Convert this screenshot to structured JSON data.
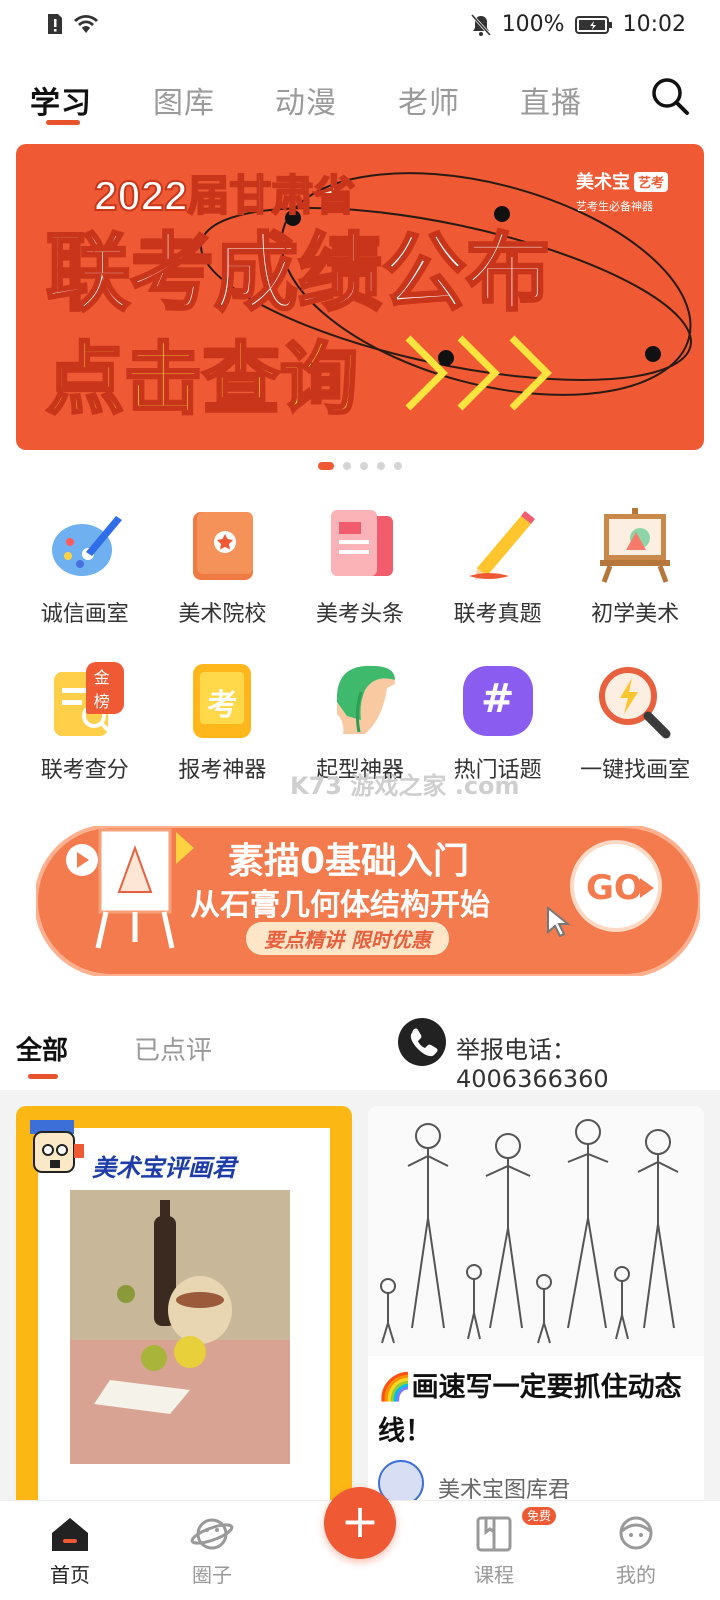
{
  "status_bar": {
    "battery": "100%",
    "time": "10:02"
  },
  "top_tabs": [
    "学习",
    "图库",
    "动漫",
    "老师",
    "直播"
  ],
  "banner": {
    "line1": "2022届甘肃省",
    "line2": "联考成绩公布",
    "line3": "点击查询",
    "brand": "美术宝",
    "brand_tag": "艺考",
    "brand_sub": "艺考生必备神器"
  },
  "grid_row1": [
    {
      "label": "诚信画室",
      "icon": "palette-icon"
    },
    {
      "label": "美术院校",
      "icon": "school-book-icon"
    },
    {
      "label": "美考头条",
      "icon": "news-icon"
    },
    {
      "label": "联考真题",
      "icon": "pencil-icon"
    },
    {
      "label": "初学美术",
      "icon": "easel-icon"
    }
  ],
  "grid_row2": [
    {
      "label": "联考查分",
      "icon": "score-icon",
      "badge": "金榜"
    },
    {
      "label": "报考神器",
      "icon": "exam-phone-icon",
      "glyph": "考"
    },
    {
      "label": "起型神器",
      "icon": "head-icon"
    },
    {
      "label": "热门话题",
      "icon": "hashtag-icon",
      "glyph": "#"
    },
    {
      "label": "一键找画室",
      "icon": "magnifier-bolt-icon"
    }
  ],
  "watermark": "K73 游戏之家 .com",
  "promo": {
    "title": "素描0基础入门",
    "subtitle": "从石膏几何体结构开始",
    "tag": "要点精讲 限时优惠",
    "go": "GO"
  },
  "feed_tabs": [
    "全部",
    "已点评"
  ],
  "hotline": "举报电话：4006366360",
  "cards": {
    "left_header": "美术宝评画君",
    "right_title": "🌈画速写一定要抓住动态线！",
    "right_author": "美术宝图库君"
  },
  "bottom_tabs": [
    "首页",
    "圈子",
    "课程",
    "我的"
  ],
  "free_badge": "免费",
  "colors": {
    "accent": "#ef5a34",
    "banner_yellow": "#ffe33f",
    "card_yellow": "#fbb714"
  }
}
